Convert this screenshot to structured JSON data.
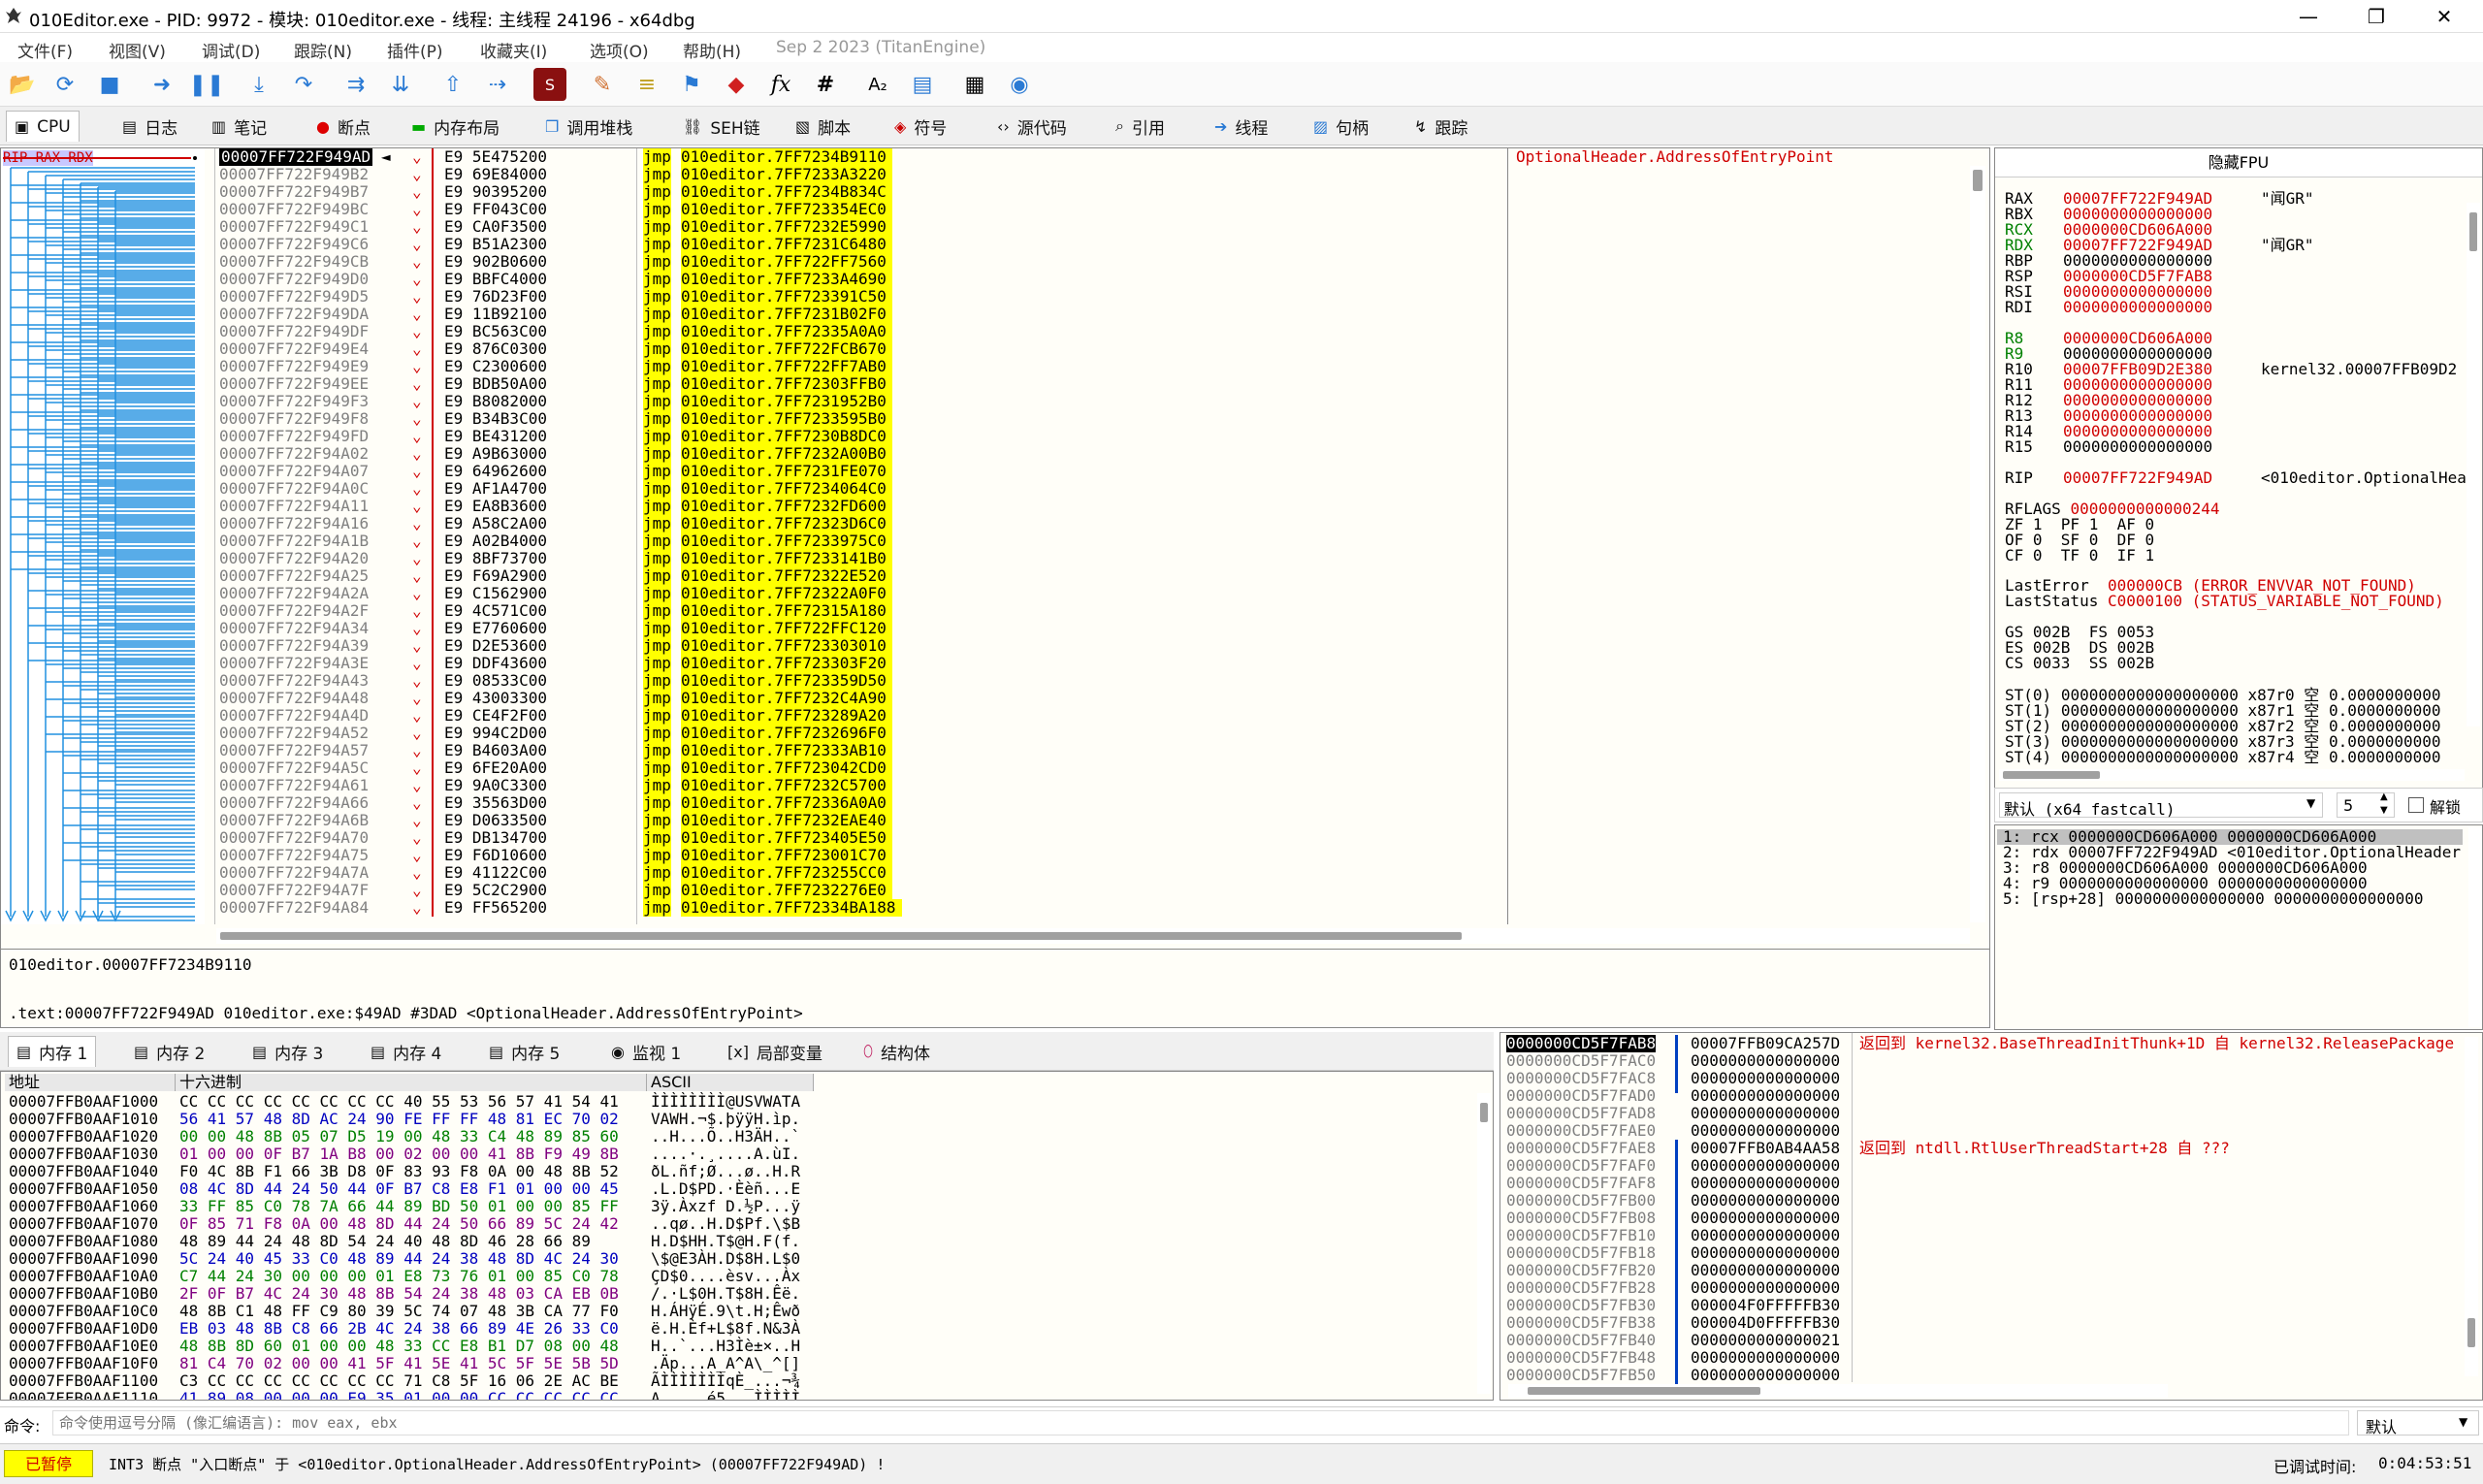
{
  "window": {
    "title": "010Editor.exe - PID: 9972 - 模块: 010editor.exe - 线程: 主线程 24196 - x64dbg"
  },
  "menu": [
    "文件(F)",
    "视图(V)",
    "调试(D)",
    "跟踪(N)",
    "插件(P)",
    "收藏夹(I)",
    "选项(O)",
    "帮助(H)",
    "Sep 2 2023 (TitanEngine)"
  ],
  "tabs": [
    {
      "label": "CPU",
      "icon": "cpu-icon"
    },
    {
      "label": "日志",
      "icon": "log-icon"
    },
    {
      "label": "笔记",
      "icon": "notes-icon"
    },
    {
      "label": "断点",
      "icon": "breakpoint-icon"
    },
    {
      "label": "内存布局",
      "icon": "memory-map-icon"
    },
    {
      "label": "调用堆栈",
      "icon": "call-stack-icon"
    },
    {
      "label": "SEH链",
      "icon": "seh-icon"
    },
    {
      "label": "脚本",
      "icon": "script-icon"
    },
    {
      "label": "符号",
      "icon": "symbols-icon"
    },
    {
      "label": "源代码",
      "icon": "source-icon"
    },
    {
      "label": "引用",
      "icon": "references-icon"
    },
    {
      "label": "线程",
      "icon": "threads-icon"
    },
    {
      "label": "句柄",
      "icon": "handles-icon"
    },
    {
      "label": "跟踪",
      "icon": "trace-icon"
    }
  ],
  "disasm": {
    "rip_label": "RIP RAX RDX",
    "comment": "OptionalHeader.AddressOfEntryPoint",
    "rows": [
      {
        "addr": "00007FF722F949AD",
        "bytes": "E9 5E475200",
        "target": "010editor.7FF7234B9110"
      },
      {
        "addr": "00007FF722F949B2",
        "bytes": "E9 69E84000",
        "target": "010editor.7FF7233A3220"
      },
      {
        "addr": "00007FF722F949B7",
        "bytes": "E9 90395200",
        "target": "010editor.7FF7234B834C"
      },
      {
        "addr": "00007FF722F949BC",
        "bytes": "E9 FF043C00",
        "target": "010editor.7FF723354EC0"
      },
      {
        "addr": "00007FF722F949C1",
        "bytes": "E9 CA0F3500",
        "target": "010editor.7FF7232E5990"
      },
      {
        "addr": "00007FF722F949C6",
        "bytes": "E9 B51A2300",
        "target": "010editor.7FF7231C6480"
      },
      {
        "addr": "00007FF722F949CB",
        "bytes": "E9 902B0600",
        "target": "010editor.7FF722FF7560"
      },
      {
        "addr": "00007FF722F949D0",
        "bytes": "E9 BBFC4000",
        "target": "010editor.7FF7233A4690"
      },
      {
        "addr": "00007FF722F949D5",
        "bytes": "E9 76D23F00",
        "target": "010editor.7FF723391C50"
      },
      {
        "addr": "00007FF722F949DA",
        "bytes": "E9 11B92100",
        "target": "010editor.7FF7231B02F0"
      },
      {
        "addr": "00007FF722F949DF",
        "bytes": "E9 BC563C00",
        "target": "010editor.7FF72335A0A0"
      },
      {
        "addr": "00007FF722F949E4",
        "bytes": "E9 876C0300",
        "target": "010editor.7FF722FCB670"
      },
      {
        "addr": "00007FF722F949E9",
        "bytes": "E9 C2300600",
        "target": "010editor.7FF722FF7AB0"
      },
      {
        "addr": "00007FF722F949EE",
        "bytes": "E9 BDB50A00",
        "target": "010editor.7FF72303FFB0"
      },
      {
        "addr": "00007FF722F949F3",
        "bytes": "E9 B8082000",
        "target": "010editor.7FF7231952B0"
      },
      {
        "addr": "00007FF722F949F8",
        "bytes": "E9 B34B3C00",
        "target": "010editor.7FF7233595B0"
      },
      {
        "addr": "00007FF722F949FD",
        "bytes": "E9 BE431200",
        "target": "010editor.7FF7230B8DC0"
      },
      {
        "addr": "00007FF722F94A02",
        "bytes": "E9 A9B63000",
        "target": "010editor.7FF7232A00B0"
      },
      {
        "addr": "00007FF722F94A07",
        "bytes": "E9 64962600",
        "target": "010editor.7FF7231FE070"
      },
      {
        "addr": "00007FF722F94A0C",
        "bytes": "E9 AF1A4700",
        "target": "010editor.7FF7234064C0"
      },
      {
        "addr": "00007FF722F94A11",
        "bytes": "E9 EA8B3600",
        "target": "010editor.7FF7232FD600"
      },
      {
        "addr": "00007FF722F94A16",
        "bytes": "E9 A58C2A00",
        "target": "010editor.7FF72323D6C0"
      },
      {
        "addr": "00007FF722F94A1B",
        "bytes": "E9 A02B4000",
        "target": "010editor.7FF7233975C0"
      },
      {
        "addr": "00007FF722F94A20",
        "bytes": "E9 8BF73700",
        "target": "010editor.7FF7233141B0"
      },
      {
        "addr": "00007FF722F94A25",
        "bytes": "E9 F69A2900",
        "target": "010editor.7FF72322E520"
      },
      {
        "addr": "00007FF722F94A2A",
        "bytes": "E9 C1562900",
        "target": "010editor.7FF72322A0F0"
      },
      {
        "addr": "00007FF722F94A2F",
        "bytes": "E9 4C571C00",
        "target": "010editor.7FF72315A180"
      },
      {
        "addr": "00007FF722F94A34",
        "bytes": "E9 E7760600",
        "target": "010editor.7FF722FFC120"
      },
      {
        "addr": "00007FF722F94A39",
        "bytes": "E9 D2E53600",
        "target": "010editor.7FF723303010"
      },
      {
        "addr": "00007FF722F94A3E",
        "bytes": "E9 DDF43600",
        "target": "010editor.7FF723303F20"
      },
      {
        "addr": "00007FF722F94A43",
        "bytes": "E9 08533C00",
        "target": "010editor.7FF723359D50"
      },
      {
        "addr": "00007FF722F94A48",
        "bytes": "E9 43003300",
        "target": "010editor.7FF7232C4A90"
      },
      {
        "addr": "00007FF722F94A4D",
        "bytes": "E9 CE4F2F00",
        "target": "010editor.7FF723289A20"
      },
      {
        "addr": "00007FF722F94A52",
        "bytes": "E9 994C2D00",
        "target": "010editor.7FF7232696F0"
      },
      {
        "addr": "00007FF722F94A57",
        "bytes": "E9 B4603A00",
        "target": "010editor.7FF72333AB10"
      },
      {
        "addr": "00007FF722F94A5C",
        "bytes": "E9 6FE20A00",
        "target": "010editor.7FF723042CD0"
      },
      {
        "addr": "00007FF722F94A61",
        "bytes": "E9 9A0C3300",
        "target": "010editor.7FF7232C5700"
      },
      {
        "addr": "00007FF722F94A66",
        "bytes": "E9 35563D00",
        "target": "010editor.7FF72336A0A0"
      },
      {
        "addr": "00007FF722F94A6B",
        "bytes": "E9 D0633500",
        "target": "010editor.7FF7232EAE40"
      },
      {
        "addr": "00007FF722F94A70",
        "bytes": "E9 DB134700",
        "target": "010editor.7FF723405E50"
      },
      {
        "addr": "00007FF722F94A75",
        "bytes": "E9 F6D10600",
        "target": "010editor.7FF723001C70"
      },
      {
        "addr": "00007FF722F94A7A",
        "bytes": "E9 41122C00",
        "target": "010editor.7FF723255CC0"
      },
      {
        "addr": "00007FF722F94A7F",
        "bytes": "E9 5C2C2900",
        "target": "010editor.7FF7232276E0"
      },
      {
        "addr": "00007FF722F94A84",
        "bytes": "E9 FF565200",
        "target": "010editor.7FF72334BA188"
      }
    ]
  },
  "info": {
    "line1": "010editor.00007FF7234B9110",
    "line2": ".text:00007FF722F949AD 010editor.exe:$49AD #3DAD <OptionalHeader.AddressOfEntryPoint>"
  },
  "registers": {
    "header": "隐藏FPU",
    "rows": [
      {
        "name": "RAX",
        "value": "00007FF722F949AD",
        "note": "\"闻GR\"",
        "color": "red",
        "ncolor": "black"
      },
      {
        "name": "RBX",
        "value": "0000000000000000",
        "note": "",
        "color": "red",
        "ncolor": "black"
      },
      {
        "name": "RCX",
        "value": "0000000CD606A000",
        "note": "",
        "color": "red",
        "ncolor": "green"
      },
      {
        "name": "RDX",
        "value": "00007FF722F949AD",
        "note": "\"闻GR\"",
        "color": "red",
        "ncolor": "green"
      },
      {
        "name": "RBP",
        "value": "0000000000000000",
        "note": "",
        "color": "black",
        "ncolor": "black"
      },
      {
        "name": "RSP",
        "value": "0000000CD5F7FAB8",
        "note": "",
        "color": "red",
        "ncolor": "black"
      },
      {
        "name": "RSI",
        "value": "0000000000000000",
        "note": "",
        "color": "red",
        "ncolor": "black"
      },
      {
        "name": "RDI",
        "value": "0000000000000000",
        "note": "",
        "color": "red",
        "ncolor": "black"
      },
      {
        "name": "",
        "value": "",
        "note": "",
        "color": "black",
        "ncolor": "black"
      },
      {
        "name": "R8",
        "value": "0000000CD606A000",
        "note": "",
        "color": "red",
        "ncolor": "green"
      },
      {
        "name": "R9",
        "value": "0000000000000000",
        "note": "",
        "color": "black",
        "ncolor": "green"
      },
      {
        "name": "R10",
        "value": "00007FFB09D2E380",
        "note": "kernel32.00007FFB09D2",
        "color": "red",
        "ncolor": "black"
      },
      {
        "name": "R11",
        "value": "0000000000000000",
        "note": "",
        "color": "red",
        "ncolor": "black"
      },
      {
        "name": "R12",
        "value": "0000000000000000",
        "note": "",
        "color": "red",
        "ncolor": "black"
      },
      {
        "name": "R13",
        "value": "0000000000000000",
        "note": "",
        "color": "red",
        "ncolor": "black"
      },
      {
        "name": "R14",
        "value": "0000000000000000",
        "note": "",
        "color": "red",
        "ncolor": "black"
      },
      {
        "name": "R15",
        "value": "0000000000000000",
        "note": "",
        "color": "black",
        "ncolor": "black"
      },
      {
        "name": "",
        "value": "",
        "note": "",
        "color": "black",
        "ncolor": "black"
      },
      {
        "name": "RIP",
        "value": "00007FF722F949AD",
        "note": "<010editor.OptionalHea",
        "color": "red",
        "ncolor": "black"
      }
    ],
    "rflags_label": "RFLAGS",
    "rflags": "0000000000000244",
    "flags": [
      "ZF 1  PF 1  AF 0",
      "OF 0  SF 0  DF 0",
      "CF 0  TF 0  IF 1"
    ],
    "lasterror_label": "LastError",
    "lasterror": "000000CB (ERROR_ENVVAR_NOT_FOUND)",
    "laststatus_label": "LastStatus",
    "laststatus": "C0000100 (STATUS_VARIABLE_NOT_FOUND)",
    "segs": [
      "GS 002B  FS 0053",
      "ES 002B  DS 002B",
      "CS 0033  SS 002B"
    ],
    "fpu": [
      {
        "n": "ST(0)",
        "v": "0000000000000000000 x87r0",
        "e": "空",
        "f": "0.0000000000"
      },
      {
        "n": "ST(1)",
        "v": "0000000000000000000 x87r1",
        "e": "空",
        "f": "0.0000000000"
      },
      {
        "n": "ST(2)",
        "v": "0000000000000000000 x87r2",
        "e": "空",
        "f": "0.0000000000"
      },
      {
        "n": "ST(3)",
        "v": "0000000000000000000 x87r3",
        "e": "空",
        "f": "0.0000000000"
      },
      {
        "n": "ST(4)",
        "v": "0000000000000000000 x87r4",
        "e": "空",
        "f": "0.0000000000"
      }
    ]
  },
  "callconv": {
    "value": "默认 (x64 fastcall)",
    "count": "5",
    "unlock": "解锁"
  },
  "args": [
    "1: rcx 0000000CD606A000 0000000CD606A000",
    "2: rdx 00007FF722F949AD <010editor.OptionalHeader",
    "3: r8 0000000CD606A000 0000000CD606A000",
    "4: r9 0000000000000000 0000000000000000",
    "5: [rsp+28] 0000000000000000 0000000000000000"
  ],
  "memtabs": [
    {
      "label": "内存 1",
      "icon": "memory-icon"
    },
    {
      "label": "内存 2",
      "icon": "memory-icon"
    },
    {
      "label": "内存 3",
      "icon": "memory-icon"
    },
    {
      "label": "内存 4",
      "icon": "memory-icon"
    },
    {
      "label": "内存 5",
      "icon": "memory-icon"
    },
    {
      "label": "监视 1",
      "icon": "watch-icon"
    },
    {
      "label": "局部变量",
      "icon": "locals-icon"
    },
    {
      "label": "结构体",
      "icon": "struct-icon"
    }
  ],
  "dump": {
    "col_addr": "地址",
    "col_hex": "十六进制",
    "col_ascii": "ASCII",
    "rows": [
      {
        "a": "00007FFB0AAF1000",
        "h": "CC CC CC CC CC CC CC CC 40 55 53 56 57 41 54 41",
        "s": "ÌÌÌÌÌÌÌÌ@USVWATA"
      },
      {
        "a": "00007FFB0AAF1010",
        "h": "56 41 57 48 8D AC 24 90 FE FF FF 48 81 EC 70 02",
        "s": "VAWH.¬$.þÿÿH.ìp."
      },
      {
        "a": "00007FFB0AAF1020",
        "h": "00 00 48 8B 05 07 D5 19 00 48 33 C4 48 89 85 60",
        "s": "..H...Õ..H3ÄH..`"
      },
      {
        "a": "00007FFB0AAF1030",
        "h": "01 00 00 0F B7 1A B8 00 02 00 00 41 8B F9 49 8B",
        "s": "....·.¸....A.ùI."
      },
      {
        "a": "00007FFB0AAF1040",
        "h": "F0 4C 8B F1 66 3B D8 0F 83 93 F8 0A 00 48 8B 52",
        "s": "ðL.ñf;Ø...ø..H.R"
      },
      {
        "a": "00007FFB0AAF1050",
        "h": "08 4C 8D 44 24 50 44 0F B7 C8 E8 F1 01 00 00 45",
        "s": ".L.D$PD.·Èèñ...E"
      },
      {
        "a": "00007FFB0AAF1060",
        "h": "33 FF 85 C0 78 7A 66 44 89 BD 50 01 00 00 85 FF",
        "s": "3ÿ.Àxzf D.½P...ÿ"
      },
      {
        "a": "00007FFB0AAF1070",
        "h": "0F 85 71 F8 0A 00 48 8D 44 24 50 66 89 5C 24 42",
        "s": "..qø..H.D$Pf.\\$B"
      },
      {
        "a": "00007FFB0AAF1080",
        "h": "48 89 44 24 48 8D 54 24 40 48 8D 46 28 66 89",
        "s": "H.D$HH.T$@H.F(f."
      },
      {
        "a": "00007FFB0AAF1090",
        "h": "5C 24 40 45 33 C0 48 89 44 24 38 48 8D 4C 24 30",
        "s": "\\$@E3ÀH.D$8H.L$0"
      },
      {
        "a": "00007FFB0AAF10A0",
        "h": "C7 44 24 30 00 00 00 01 E8 73 76 01 00 85 C0 78",
        "s": "ÇD$0....èsv...Àx"
      },
      {
        "a": "00007FFB0AAF10B0",
        "h": "2F 0F B7 4C 24 30 48 8B 54 24 38 48 03 CA EB 0B",
        "s": "/.·L$0H.T$8H.Êë."
      },
      {
        "a": "00007FFB0AAF10C0",
        "h": "48 8B C1 48 FF C9 80 39 5C 74 07 48 3B CA 77 F0",
        "s": "H.ÁHÿÉ.9\\t.H;Êwð"
      },
      {
        "a": "00007FFB0AAF10D0",
        "h": "EB 03 48 8B C8 66 2B 4C 24 38 66 89 4E 26 33 C0",
        "s": "ë.H.Èf+L$8f.N&3À"
      },
      {
        "a": "00007FFB0AAF10E0",
        "h": "48 8B 8D 60 01 00 00 48 33 CC E8 B1 D7 08 00 48",
        "s": "H..`...H3Ìè±×..H"
      },
      {
        "a": "00007FFB0AAF10F0",
        "h": "81 C4 70 02 00 00 41 5F 41 5E 41 5C 5F 5E 5B 5D",
        "s": ".Äp...A_A^A\\_^[]"
      },
      {
        "a": "00007FFB0AAF1100",
        "h": "C3 CC CC CC CC CC CC CC 71 C8 5F 16 06 2E AC BE",
        "s": "ÃÌÌÌÌÌÌÌqÈ_...¬¾"
      },
      {
        "a": "00007FFB0AAF1110",
        "h": "41 89 08 00 00 00 E9 35 01 00 00 CC CC CC CC CC",
        "s": "A.....é5...ÌÌÌÌÌ"
      }
    ]
  },
  "stack": {
    "rows": [
      {
        "a": "0000000CD5F7FAB8",
        "v": "00007FFB09CA257D",
        "c": "返回到 kernel32.BaseThreadInitThunk+1D 自 kernel32.ReleasePackage"
      },
      {
        "a": "0000000CD5F7FAC0",
        "v": "0000000000000000",
        "c": ""
      },
      {
        "a": "0000000CD5F7FAC8",
        "v": "0000000000000000",
        "c": ""
      },
      {
        "a": "0000000CD5F7FAD0",
        "v": "0000000000000000",
        "c": ""
      },
      {
        "a": "0000000CD5F7FAD8",
        "v": "0000000000000000",
        "c": ""
      },
      {
        "a": "0000000CD5F7FAE0",
        "v": "0000000000000000",
        "c": ""
      },
      {
        "a": "0000000CD5F7FAE8",
        "v": "00007FFB0AB4AA58",
        "c": "返回到 ntdll.RtlUserThreadStart+28 自 ???"
      },
      {
        "a": "0000000CD5F7FAF0",
        "v": "0000000000000000",
        "c": ""
      },
      {
        "a": "0000000CD5F7FAF8",
        "v": "0000000000000000",
        "c": ""
      },
      {
        "a": "0000000CD5F7FB00",
        "v": "0000000000000000",
        "c": ""
      },
      {
        "a": "0000000CD5F7FB08",
        "v": "0000000000000000",
        "c": ""
      },
      {
        "a": "0000000CD5F7FB10",
        "v": "0000000000000000",
        "c": ""
      },
      {
        "a": "0000000CD5F7FB18",
        "v": "0000000000000000",
        "c": ""
      },
      {
        "a": "0000000CD5F7FB20",
        "v": "0000000000000000",
        "c": ""
      },
      {
        "a": "0000000CD5F7FB28",
        "v": "0000000000000000",
        "c": ""
      },
      {
        "a": "0000000CD5F7FB30",
        "v": "000004F0FFFFFB30",
        "c": ""
      },
      {
        "a": "0000000CD5F7FB38",
        "v": "000004D0FFFFFB30",
        "c": ""
      },
      {
        "a": "0000000CD5F7FB40",
        "v": "0000000000000021",
        "c": ""
      },
      {
        "a": "0000000CD5F7FB48",
        "v": "0000000000000000",
        "c": ""
      },
      {
        "a": "0000000CD5F7FB50",
        "v": "0000000000000000",
        "c": ""
      }
    ]
  },
  "command": {
    "label": "命令:",
    "placeholder": "命令使用逗号分隔 (像汇编语言): mov eax, ebx",
    "mode": "默认"
  },
  "status": {
    "state": "已暂停",
    "message": "INT3 断点 \"入口断点\" 于 <010editor.OptionalHeader.AddressOfEntryPoint> (00007FF722F949AD) !",
    "time_label": "已调试时间:",
    "time": "0:04:53:51"
  }
}
